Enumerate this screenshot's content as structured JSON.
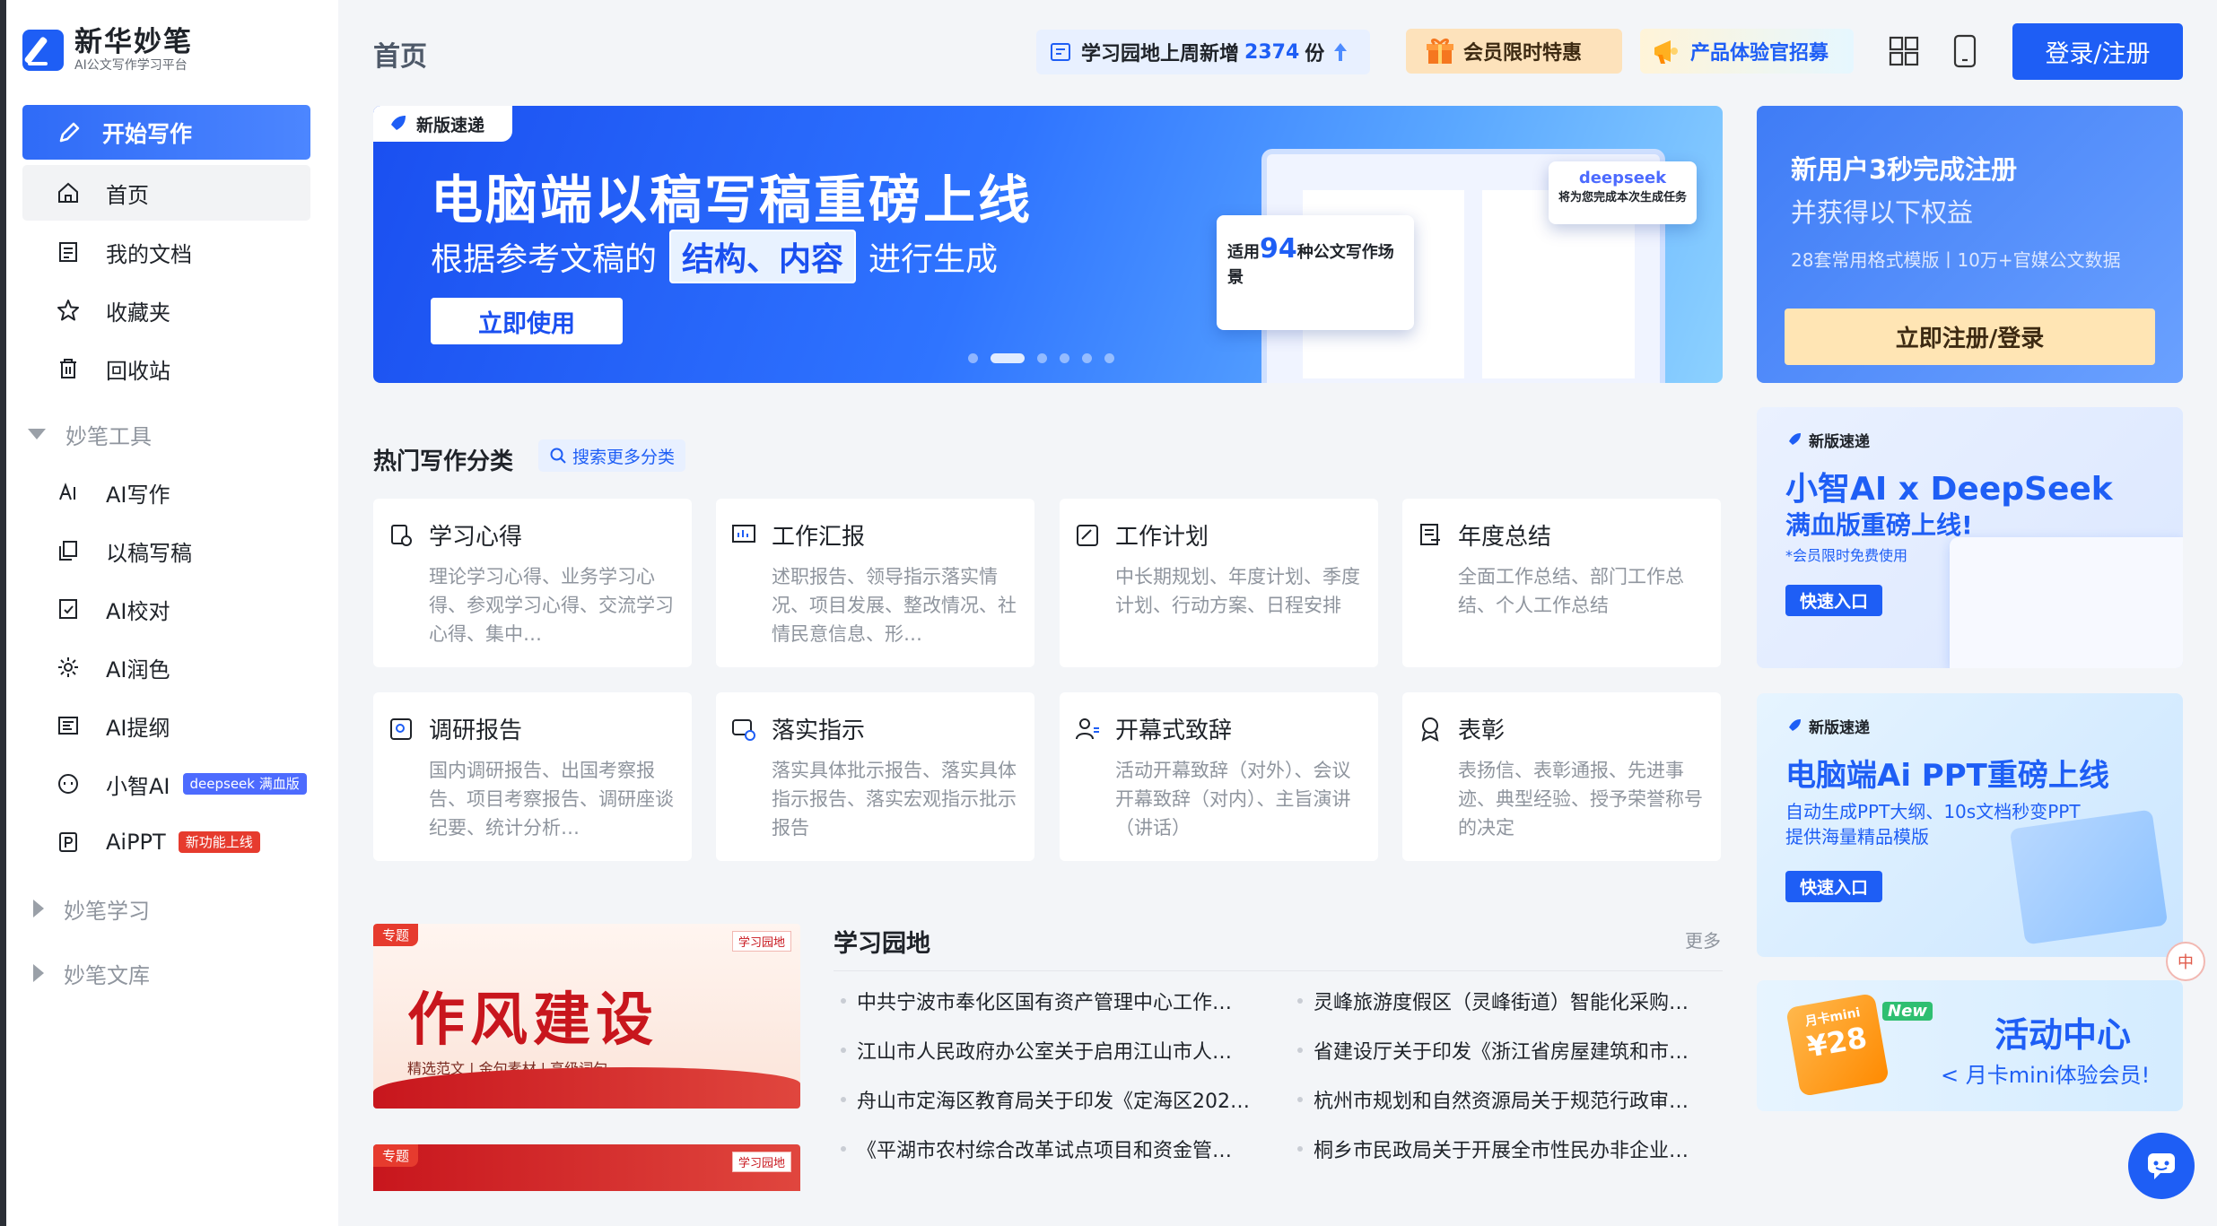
{
  "brand": {
    "name": "新华妙笔",
    "subtitle": "AI公文写作学习平台"
  },
  "sidebar": {
    "start_label": "开始写作",
    "main_items": [
      {
        "label": "首页",
        "icon": "home-icon"
      },
      {
        "label": "我的文档",
        "icon": "document-icon"
      },
      {
        "label": "收藏夹",
        "icon": "star-icon"
      },
      {
        "label": "回收站",
        "icon": "trash-icon"
      }
    ],
    "group_tools": "妙笔工具",
    "tools": [
      {
        "label": "AI写作",
        "icon": "ai-write-icon"
      },
      {
        "label": "以稿写稿",
        "icon": "copy-write-icon"
      },
      {
        "label": "AI校对",
        "icon": "proofread-icon"
      },
      {
        "label": "AI润色",
        "icon": "polish-icon"
      },
      {
        "label": "AI提纲",
        "icon": "outline-icon"
      },
      {
        "label": "小智AI",
        "icon": "bot-icon",
        "tag": "deepseek 满血版"
      },
      {
        "label": "AiPPT",
        "icon": "ppt-icon",
        "tag": "新功能上线"
      }
    ],
    "group_learn": "妙笔学习",
    "group_library": "妙笔文库"
  },
  "header": {
    "title": "首页",
    "stat_prefix": "学习园地上周新增",
    "stat_number": "2374",
    "stat_suffix": "份",
    "vip_label": "会员限时特惠",
    "experience_label": "产品体验官招募",
    "login_label": "登录/注册"
  },
  "banner": {
    "tag": "新版速递",
    "title": "电脑端以稿写稿重磅上线",
    "sub_before": "根据参考文稿的",
    "sub_highlight": "结构、内容",
    "sub_after": "进行生成",
    "button": "立即使用",
    "card_prefix": "适用",
    "card_number": "94",
    "card_suffix": "种公文写作场景",
    "ds_brand": "deepseek",
    "ds_text": "将为您完成本次生成任务",
    "dot_count": 6,
    "active_dot": 1
  },
  "promo": {
    "line1": "新用户3秒完成注册",
    "line2": "并获得以下权益",
    "line3": "28套常用格式模版丨10万+官媒公文数据",
    "button": "立即注册/登录"
  },
  "categories": {
    "title": "热门写作分类",
    "search_label": "搜索更多分类",
    "items": [
      {
        "name": "学习心得",
        "desc": "理论学习心得、业务学习心得、参观学习心得、交流学习心得、集中…",
        "icon": "study-icon"
      },
      {
        "name": "工作汇报",
        "desc": "述职报告、领导指示落实情况、项目发展、整改情况、社情民意信息、形…",
        "icon": "report-icon"
      },
      {
        "name": "工作计划",
        "desc": "中长期规划、年度计划、季度计划、行动方案、日程安排",
        "icon": "plan-icon"
      },
      {
        "name": "年度总结",
        "desc": "全面工作总结、部门工作总结、个人工作总结",
        "icon": "summary-icon"
      },
      {
        "name": "调研报告",
        "desc": "国内调研报告、出国考察报告、项目考察报告、调研座谈纪要、统计分析…",
        "icon": "research-icon"
      },
      {
        "name": "落实指示",
        "desc": "落实具体批示报告、落实具体指示报告、落实宏观指示批示报告",
        "icon": "instruction-icon"
      },
      {
        "name": "开幕式致辞",
        "desc": "活动开幕致辞（对外）、会议开幕致辞（对内）、主旨演讲（讲话）",
        "icon": "speech-icon"
      },
      {
        "name": "表彰",
        "desc": "表扬信、表彰通报、先进事迹、典型经验、授予荣誉称号的决定",
        "icon": "award-icon"
      }
    ]
  },
  "topics": {
    "tag": "专题",
    "logo": "学习园地",
    "title": "作风建设",
    "subtitle": "精选范文 | 金句素材 | 高级词句"
  },
  "learning": {
    "title": "学习园地",
    "more": "更多",
    "news": [
      "中共宁波市奉化区国有资产管理中心工作…",
      "灵峰旅游度假区（灵峰街道）智能化采购…",
      "江山市人民政府办公室关于启用江山市人…",
      "省建设厅关于印发《浙江省房屋建筑和市…",
      "舟山市定海区教育局关于印发《定海区202…",
      "杭州市规划和自然资源局关于规范行政审…",
      "《平湖市农村综合改革试点项目和资金管…",
      "桐乡市民政局关于开展全市性民办非企业…"
    ]
  },
  "right_cards": {
    "deepseek": {
      "tag": "新版速递",
      "title": "小智AI x DeepSeek",
      "subtitle": "满血版重磅上线!",
      "note": "*会员限时免费使用",
      "button": "快速入口"
    },
    "ppt": {
      "tag": "新版速递",
      "title": "电脑端Ai PPT重磅上线",
      "line1": "自动生成PPT大纲、10s文档秒变PPT",
      "line2": "提供海量精品模版",
      "button": "快速入口"
    },
    "activity": {
      "badge_top": "月卡mini",
      "badge_price": "¥28",
      "new": "New",
      "title": "活动中心",
      "subtitle": "< 月卡mini体验会员!"
    }
  },
  "colors": {
    "primary": "#1e5ef5",
    "danger": "#e63b2e"
  }
}
